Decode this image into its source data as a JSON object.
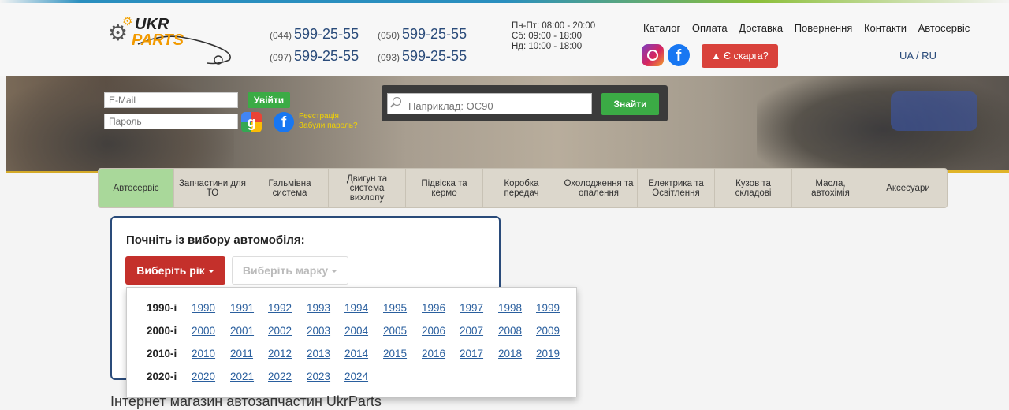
{
  "logo": {
    "ukr": "UKR",
    "parts": "PARTS"
  },
  "phones": [
    {
      "code": "(044)",
      "number": "599-25-55"
    },
    {
      "code": "(050)",
      "number": "599-25-55"
    },
    {
      "code": "(097)",
      "number": "599-25-55"
    },
    {
      "code": "(093)",
      "number": "599-25-55"
    }
  ],
  "hours": [
    "Пн-Пт: 08:00 - 20:00",
    "Сб: 09:00 - 18:00",
    "Нд: 10:00 - 18:00"
  ],
  "topnav": [
    "Каталог",
    "Оплата",
    "Доставка",
    "Повернення",
    "Контакти",
    "Автосервіс"
  ],
  "complaint_label": "Є скарга?",
  "lang": "UA / RU",
  "login": {
    "email_placeholder": "E-Mail",
    "password_placeholder": "Пароль",
    "login_button": "Увійти",
    "register_link": "Реєстрація",
    "forgot_link": "Забули пароль?"
  },
  "search": {
    "placeholder": "Наприклад: OC90",
    "button": "Знайти"
  },
  "categories": [
    "Автосервіс",
    "Запчастини для ТО",
    "Гальмівна система",
    "Двигун та система вихлопу",
    "Підвіска та кермо",
    "Коробка передач",
    "Охолодження та опалення",
    "Електрика та Освітлення",
    "Кузов та складові",
    "Масла, автохімія",
    "Аксесуари"
  ],
  "picker": {
    "title": "Почніть із вибору автомобіля:",
    "year_button": "Виберіть рік",
    "brand_button": "Виберіть марку"
  },
  "decades": [
    {
      "label": "1990-і",
      "years": [
        "1990",
        "1991",
        "1992",
        "1993",
        "1994",
        "1995",
        "1996",
        "1997",
        "1998",
        "1999"
      ]
    },
    {
      "label": "2000-і",
      "years": [
        "2000",
        "2001",
        "2002",
        "2003",
        "2004",
        "2005",
        "2006",
        "2007",
        "2008",
        "2009"
      ]
    },
    {
      "label": "2010-і",
      "years": [
        "2010",
        "2011",
        "2012",
        "2013",
        "2014",
        "2015",
        "2016",
        "2017",
        "2018",
        "2019"
      ]
    },
    {
      "label": "2020-і",
      "years": [
        "2020",
        "2021",
        "2022",
        "2023",
        "2024"
      ]
    }
  ],
  "footer_title": "Інтернет магазин автозапчастин UkrParts"
}
